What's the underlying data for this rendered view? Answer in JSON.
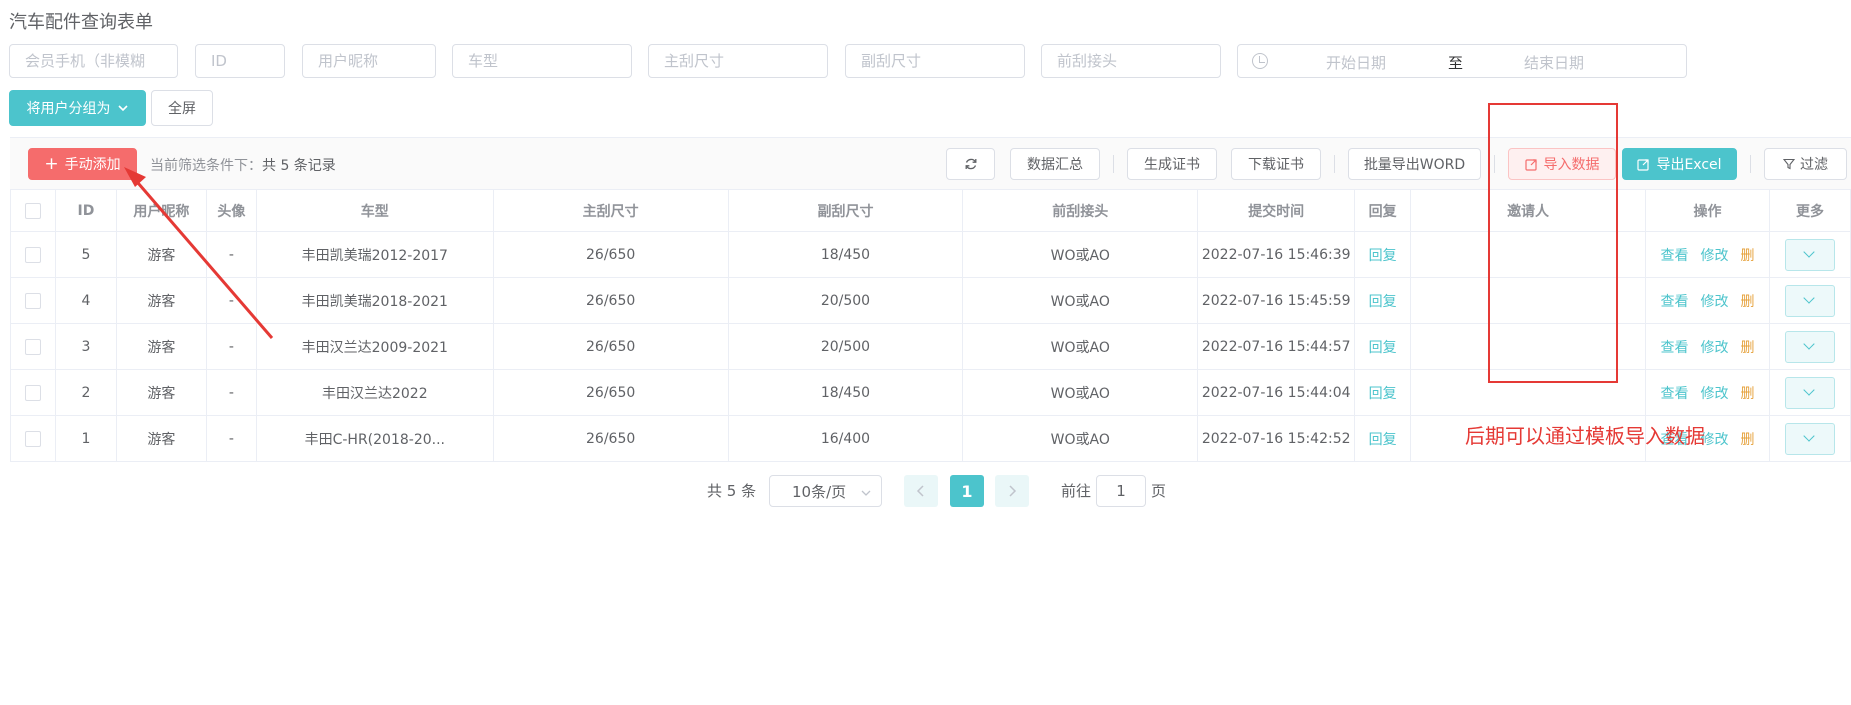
{
  "page": {
    "title": "汽车配件查询表单"
  },
  "filters": {
    "phone": "会员手机（非模糊",
    "id": "ID",
    "nickname": "用户昵称",
    "model": "车型",
    "main_wiper": "主刮尺寸",
    "sub_wiper": "副刮尺寸",
    "front_connector": "前刮接头",
    "start_date": "开始日期",
    "date_sep": "至",
    "end_date": "结束日期"
  },
  "actions": {
    "group_users": "将用户分组为",
    "fullscreen": "全屏"
  },
  "toolbar": {
    "add": "手动添加",
    "hint_prefix": "当前筛选条件下：",
    "hint_count": "共 5 条记录",
    "summary": "数据汇总",
    "gen_cert": "生成证书",
    "download_cert": "下载证书",
    "export_word": "批量导出WORD",
    "import_data": "导入数据",
    "export_excel": "导出Excel",
    "filter": "过滤"
  },
  "table": {
    "headers": [
      "ID",
      "用户昵称",
      "头像",
      "车型",
      "主刮尺寸",
      "副刮尺寸",
      "前刮接头",
      "提交时间",
      "回复",
      "邀请人",
      "操作",
      "更多"
    ],
    "rows": [
      {
        "id": "5",
        "nickname": "游客",
        "avatar": "-",
        "model": "丰田凯美瑞2012-2017",
        "main": "26/650",
        "sub": "18/450",
        "connector": "WO或AO",
        "time": "2022-07-16 15:46:39",
        "reply": "回复",
        "inviter": ""
      },
      {
        "id": "4",
        "nickname": "游客",
        "avatar": "-",
        "model": "丰田凯美瑞2018-2021",
        "main": "26/650",
        "sub": "20/500",
        "connector": "WO或AO",
        "time": "2022-07-16 15:45:59",
        "reply": "回复",
        "inviter": ""
      },
      {
        "id": "3",
        "nickname": "游客",
        "avatar": "-",
        "model": "丰田汉兰达2009-2021",
        "main": "26/650",
        "sub": "20/500",
        "connector": "WO或AO",
        "time": "2022-07-16 15:44:57",
        "reply": "回复",
        "inviter": ""
      },
      {
        "id": "2",
        "nickname": "游客",
        "avatar": "-",
        "model": "丰田汉兰达2022",
        "main": "26/650",
        "sub": "18/450",
        "connector": "WO或AO",
        "time": "2022-07-16 15:44:04",
        "reply": "回复",
        "inviter": ""
      },
      {
        "id": "1",
        "nickname": "游客",
        "avatar": "-",
        "model": "丰田C-HR(2018-20...",
        "main": "26/650",
        "sub": "16/400",
        "connector": "WO或AO",
        "time": "2022-07-16 15:42:52",
        "reply": "回复",
        "inviter": ""
      }
    ],
    "op_view": "查看",
    "op_edit": "修改",
    "op_delete": "删"
  },
  "pagination": {
    "total": "共 5 条",
    "page_size": "10条/页",
    "current": "1",
    "goto_prefix": "前往",
    "goto_value": "1",
    "goto_suffix": "页"
  },
  "annotation": {
    "text": "后期可以通过模板导入数据",
    "color": "#e53935"
  },
  "colors": {
    "primary": "#4cc4cc",
    "danger": "#f56c6c",
    "warning": "#e6a23c"
  }
}
